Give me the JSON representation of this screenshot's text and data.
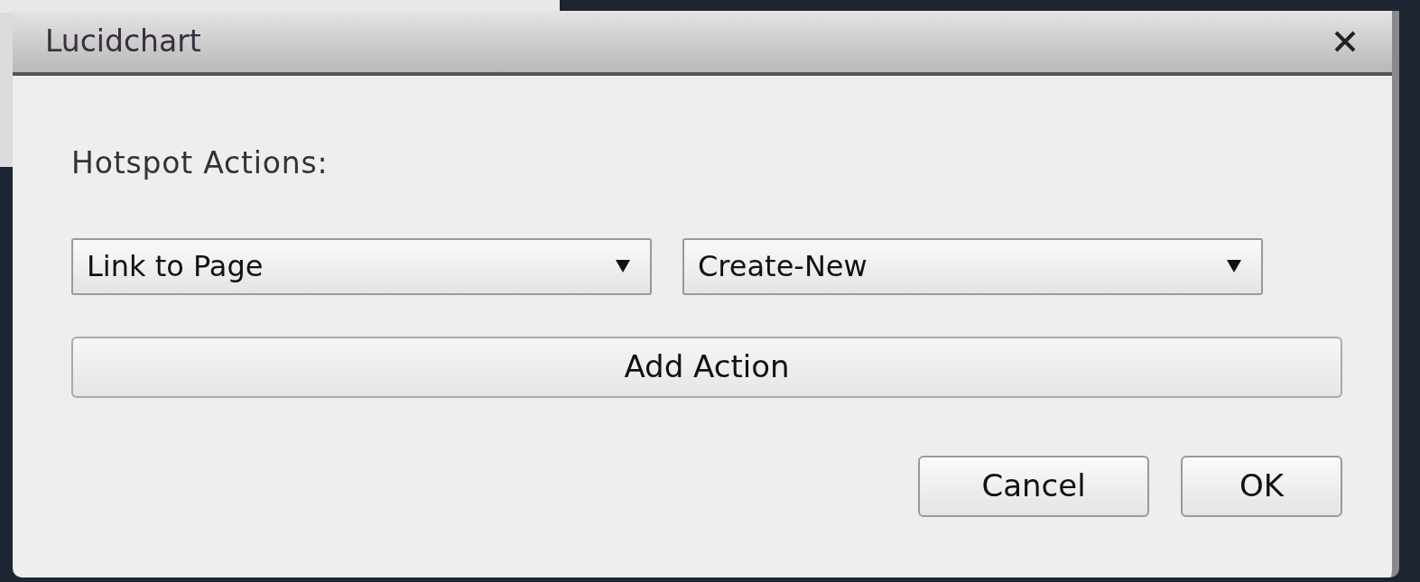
{
  "window": {
    "title": "Lucidchart"
  },
  "heading": "Hotspot Actions:",
  "selects": [
    {
      "value": "Link to Page"
    },
    {
      "value": "Create-New"
    }
  ],
  "add_button": "Add Action",
  "buttons": [
    "Cancel",
    "OK"
  ]
}
